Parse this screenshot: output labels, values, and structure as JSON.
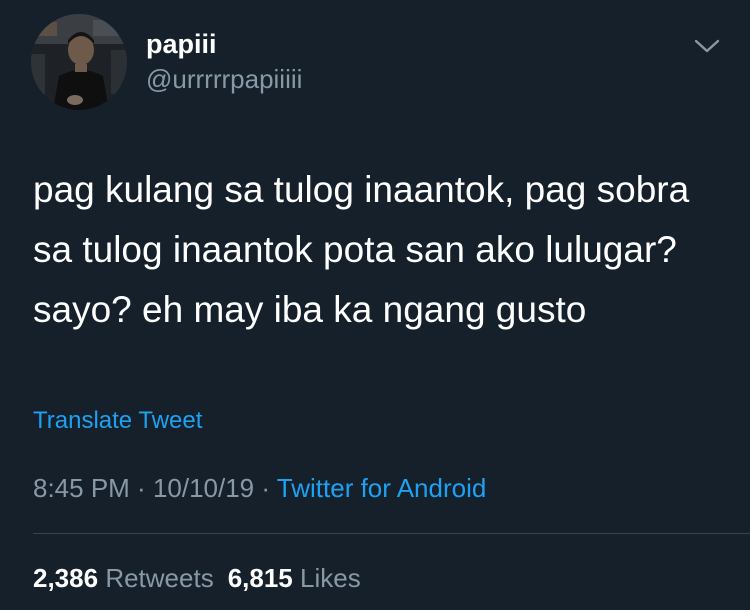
{
  "author": {
    "name": "papiii",
    "handle": "@urrrrrpapiiiii"
  },
  "icons": {
    "menu": "chevron-down-icon"
  },
  "tweet": {
    "text": "pag kulang sa tulog inaantok, pag sobra\nsa tulog inaantok pota san ako lulugar?\nsayo? eh may iba ka ngang gusto",
    "translate_label": "Translate Tweet"
  },
  "meta": {
    "time": "8:45 PM",
    "date": "10/10/19",
    "separator": " · ",
    "source": "Twitter for Android"
  },
  "stats": {
    "retweets_count": "2,386",
    "retweets_label": "Retweets",
    "likes_count": "6,815",
    "likes_label": "Likes"
  },
  "colors": {
    "background": "#15202b",
    "text_primary": "#ffffff",
    "text_secondary": "#8899a6",
    "link": "#1da1f2",
    "divider": "#38444d"
  }
}
